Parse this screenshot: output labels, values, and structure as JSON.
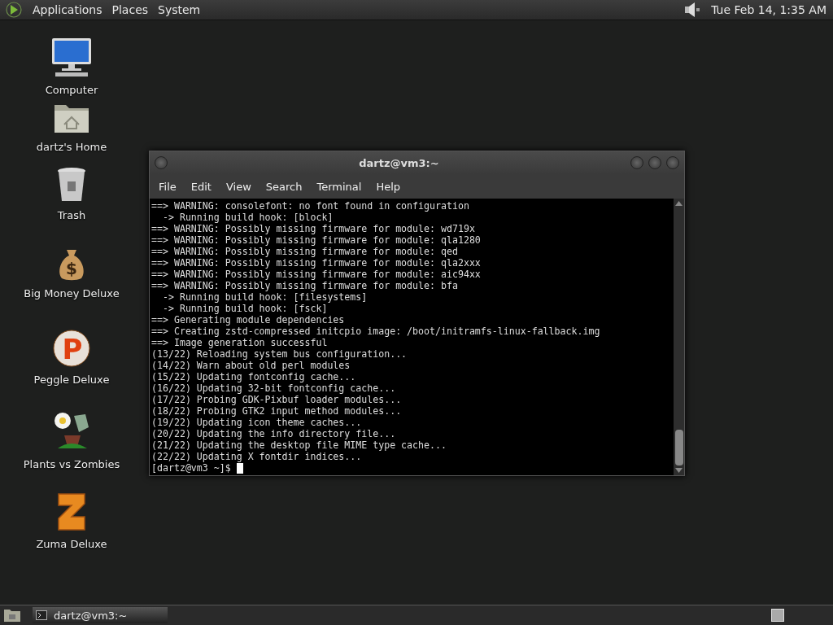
{
  "top_panel": {
    "menus": [
      "Applications",
      "Places",
      "System"
    ],
    "clock": "Tue Feb 14, 1:35 AM"
  },
  "desktop_icons": [
    {
      "kind": "computer",
      "label": "Computer"
    },
    {
      "kind": "home",
      "label": "dartz's Home"
    },
    {
      "kind": "trash",
      "label": "Trash"
    },
    {
      "kind": "moneybag",
      "label": "Big Money Deluxe",
      "glyph": "$"
    },
    {
      "kind": "peggle",
      "label": "Peggle Deluxe",
      "glyph": "P"
    },
    {
      "kind": "plant",
      "label": "Plants vs Zombies"
    },
    {
      "kind": "zuma",
      "label": "Zuma Deluxe"
    }
  ],
  "terminal": {
    "title": "dartz@vm3:~",
    "menu": [
      "File",
      "Edit",
      "View",
      "Search",
      "Terminal",
      "Help"
    ],
    "lines": [
      "==> WARNING: consolefont: no font found in configuration",
      "  -> Running build hook: [block]",
      "==> WARNING: Possibly missing firmware for module: wd719x",
      "==> WARNING: Possibly missing firmware for module: qla1280",
      "==> WARNING: Possibly missing firmware for module: qed",
      "==> WARNING: Possibly missing firmware for module: qla2xxx",
      "==> WARNING: Possibly missing firmware for module: aic94xx",
      "==> WARNING: Possibly missing firmware for module: bfa",
      "  -> Running build hook: [filesystems]",
      "  -> Running build hook: [fsck]",
      "==> Generating module dependencies",
      "==> Creating zstd-compressed initcpio image: /boot/initramfs-linux-fallback.img",
      "==> Image generation successful",
      "(13/22) Reloading system bus configuration...",
      "(14/22) Warn about old perl modules",
      "(15/22) Updating fontconfig cache...",
      "(16/22) Updating 32-bit fontconfig cache...",
      "(17/22) Probing GDK-Pixbuf loader modules...",
      "(18/22) Probing GTK2 input method modules...",
      "(19/22) Updating icon theme caches...",
      "(20/22) Updating the info directory file...",
      "(21/22) Updating the desktop file MIME type cache...",
      "(22/22) Updating X fontdir indices..."
    ],
    "prompt": "[dartz@vm3 ~]$ "
  },
  "taskbar": {
    "tasks": [
      {
        "label": "dartz@vm3:~",
        "selected": true
      }
    ]
  }
}
